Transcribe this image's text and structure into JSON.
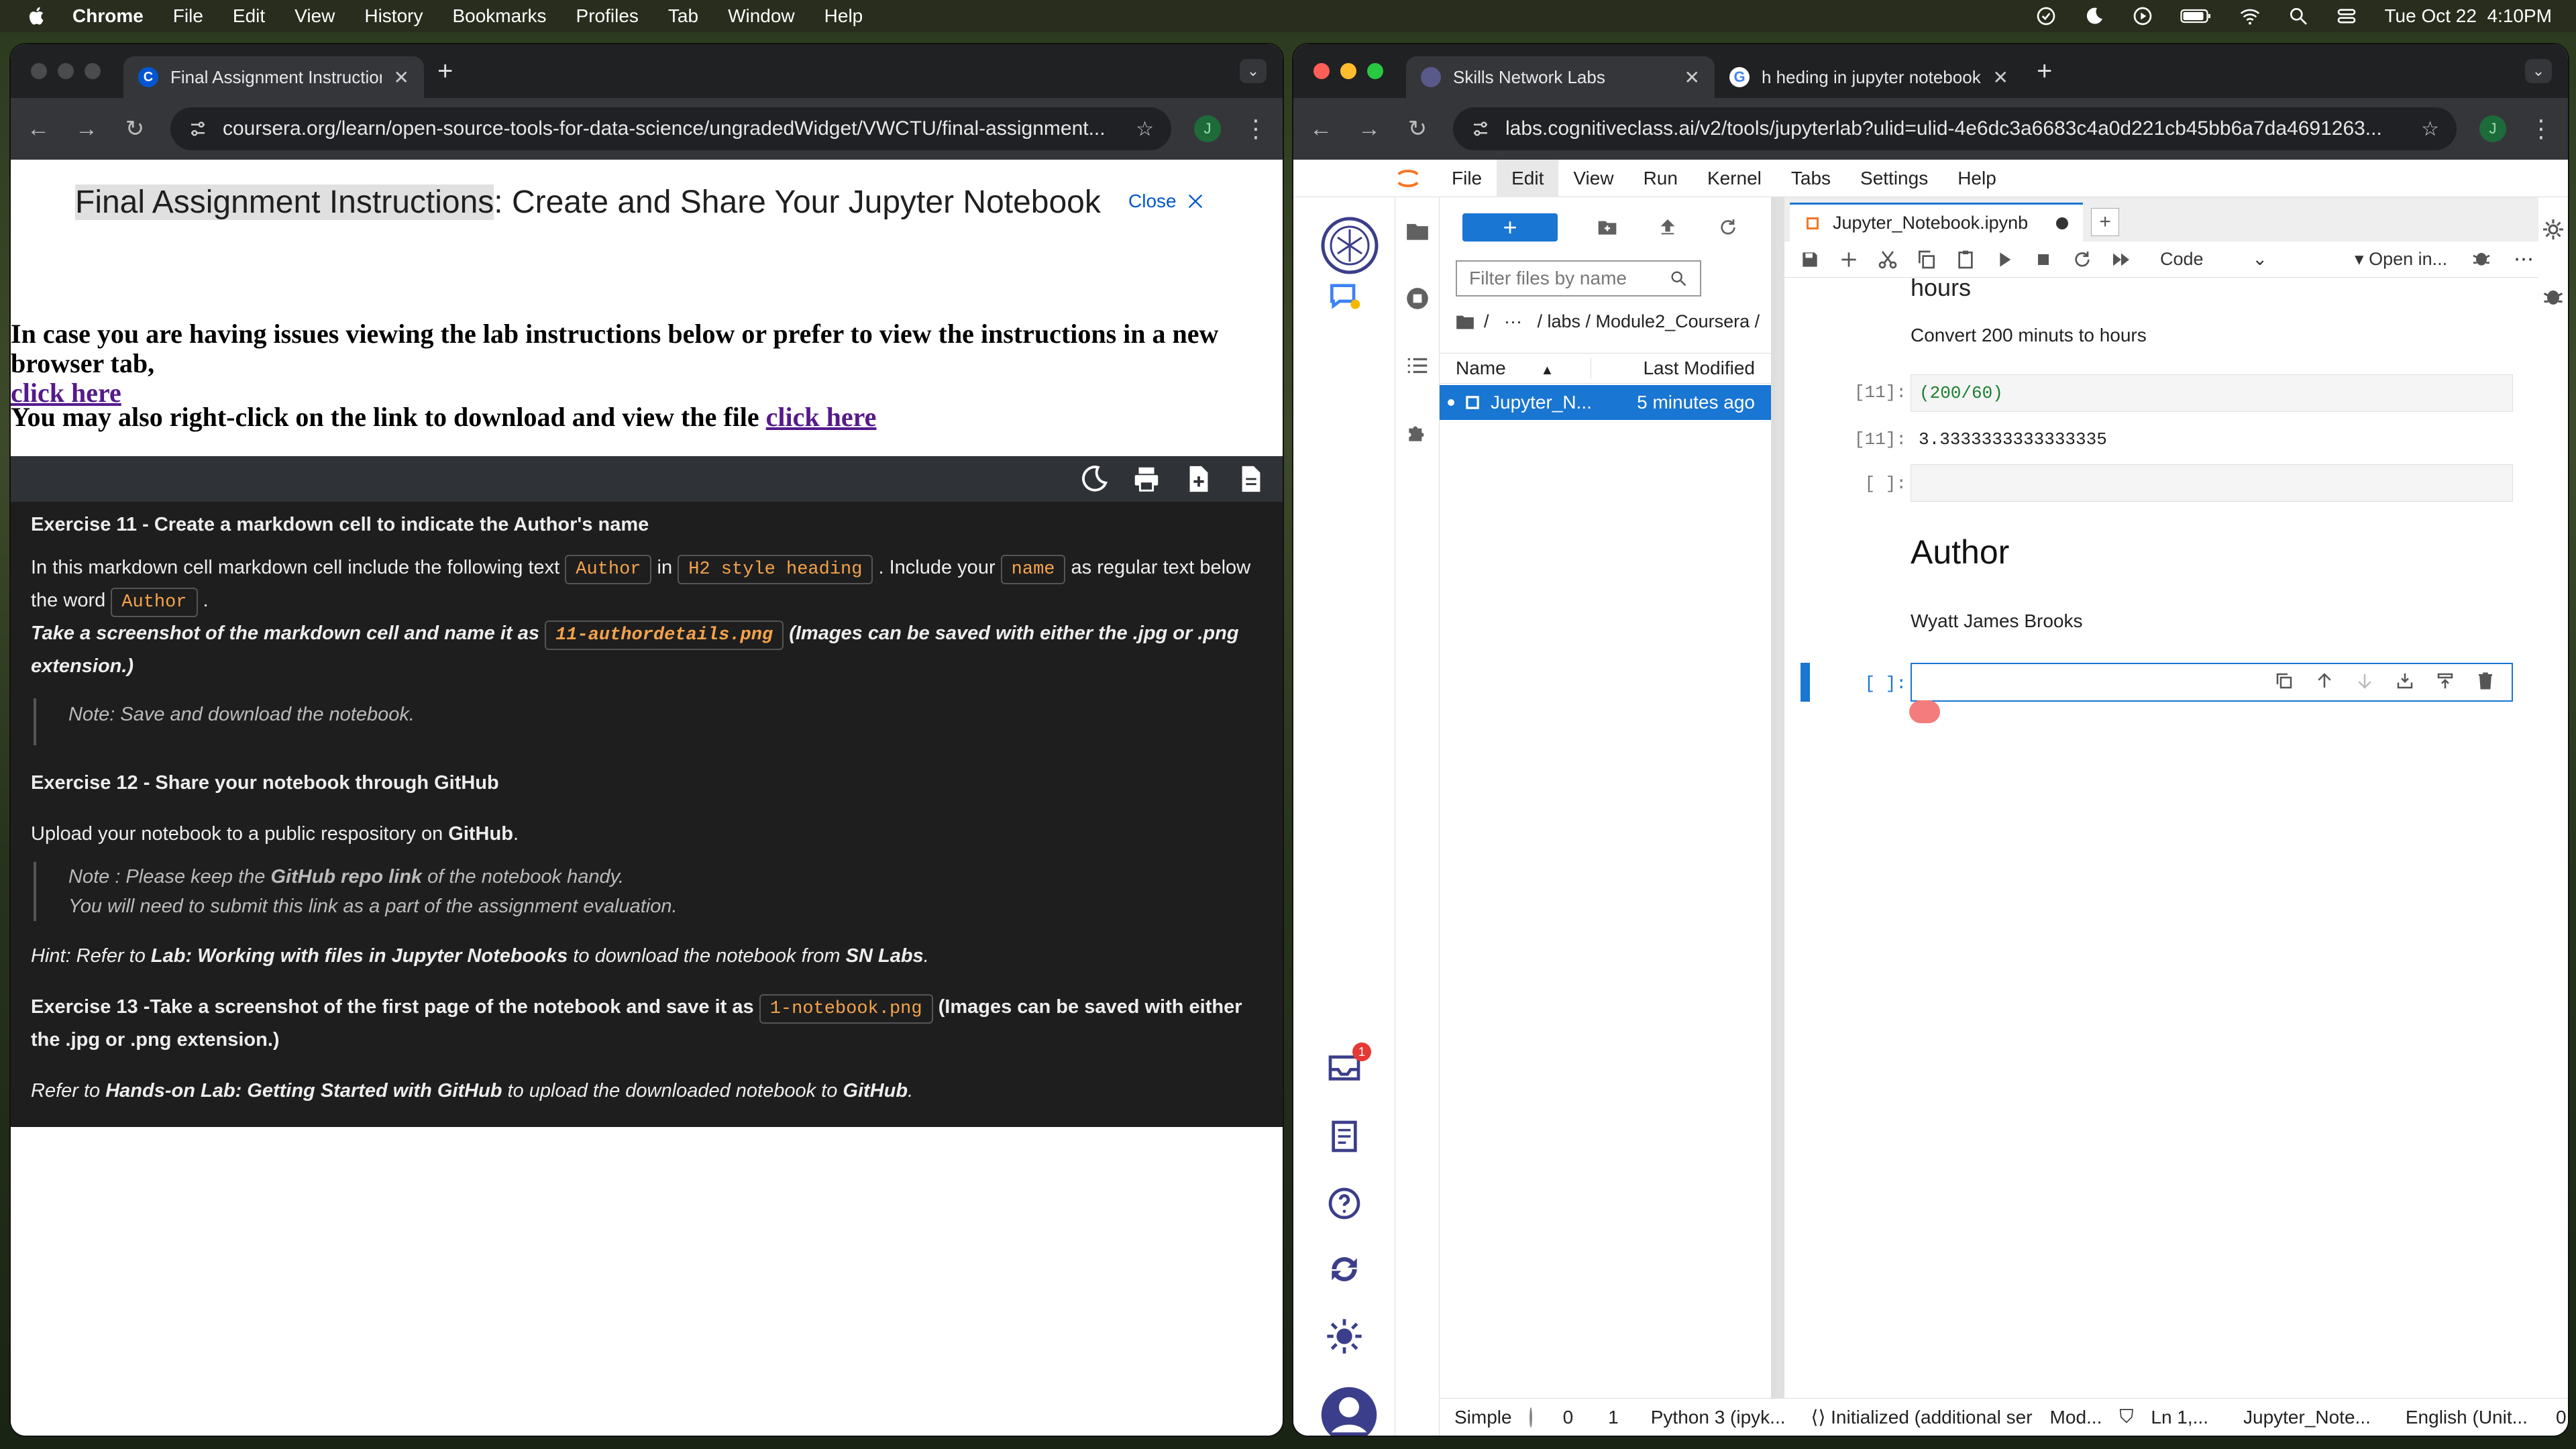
{
  "menubar": {
    "app": "Chrome",
    "items": [
      "File",
      "Edit",
      "View",
      "History",
      "Bookmarks",
      "Profiles",
      "Tab",
      "Window",
      "Help"
    ],
    "datetime": "Tue Oct 22  4:10PM"
  },
  "left_window": {
    "tab_title": "Final Assignment Instructions",
    "url": "coursera.org/learn/open-source-tools-for-data-science/ungradedWidget/VWCTU/final-assignment...",
    "profile_initial": "J",
    "page_title_highlight": "Final Assignment Instructions",
    "page_title_rest": ": Create and Share Your Jupyter Notebook",
    "close_label": "Close",
    "notice1_text": "In case you are having issues viewing the lab instructions below or prefer to view the instructions in a new browser tab,",
    "notice1_link": "click here",
    "notice2_text": "You may also right-click on the link to download and view the file",
    "notice2_link": "click here",
    "lab": {
      "ex11_heading": "Exercise 11 - Create a markdown cell to indicate the Author's name",
      "ex11_t1": "In this markdown cell markdown cell include the following text",
      "ex11_c1": "Author",
      "ex11_t2": "in",
      "ex11_c2": "H2 style heading",
      "ex11_t3": ". Include your",
      "ex11_c3": "name",
      "ex11_t4": "as regular text below the word",
      "ex11_c4": "Author",
      "ex11_t5": ".",
      "ex11_s1": "Take a screenshot of the markdown cell and name it as",
      "ex11_s_code": "11-authordetails.png",
      "ex11_s2": "(Images can be saved with either the .jpg or .png extension.)",
      "ex11_note": "Note: Save and download the notebook.",
      "ex12_heading": "Exercise 12 - Share your notebook through GitHub",
      "ex12_t1": "Upload your notebook to a public respository on",
      "ex12_t1b": "GitHub",
      "ex12_note_a": "Note : Please keep the",
      "ex12_note_b": "GitHub repo link",
      "ex12_note_c": "of the notebook handy.",
      "ex12_note2": "You will need to submit this link as a part of the assignment evaluation.",
      "hint_a": "Hint: Refer to",
      "hint_b": "Lab: Working with files in Jupyter Notebooks",
      "hint_c": "to download the notebook from",
      "hint_d": "SN Labs",
      "ex13_a": "Exercise 13 -Take a screenshot of the first page of the notebook and save it as",
      "ex13_code": "1-notebook.png",
      "ex13_b": "(Images can be saved with either the .jpg or .png extension.)",
      "ref_a": "Refer to",
      "ref_b": "Hands-on Lab: Getting Started with GitHub",
      "ref_c": "to upload the downloaded notebook to",
      "ref_d": "GitHub"
    }
  },
  "right_window": {
    "tab1_title": "Skills Network Labs",
    "tab2_title": "h heding in jupyter notebook",
    "url": "labs.cognitiveclass.ai/v2/tools/jupyterlab?ulid=ulid-4e6dc3a6683c4a0d221cb45bb6a7da4691263...",
    "profile_initial": "J",
    "jupyter_menu": [
      "File",
      "Edit",
      "View",
      "Run",
      "Kernel",
      "Tabs",
      "Settings",
      "Help"
    ],
    "notification_count": "1",
    "filebrowser": {
      "filter_placeholder": "Filter files by name",
      "crumb": "/   ···   / labs / Module2_Coursera /",
      "col_name": "Name",
      "col_modified": "Last Modified",
      "file_name": "Jupyter_N...",
      "file_modified": "5 minutes ago"
    },
    "notebook": {
      "tab_title": "Jupyter_Notebook.ipynb",
      "cell_type": "Code",
      "open_in": "Open in...",
      "md_hours": "hours",
      "md_convert": "Convert 200 minuts to hours",
      "in11_prompt": "[11]:",
      "in11_code": "(200/60)",
      "out11_prompt": "[11]:",
      "out11_value": "3.3333333333333335",
      "empty_prompt": "[ ]:",
      "h2_author": "Author",
      "author_name": "Wyatt James Brooks",
      "active_prompt": "[ ]:"
    },
    "status": {
      "mode": "Simple",
      "n1": "0",
      "n2": "1",
      "kernel": "Python 3 (ipyk...",
      "init": "Initialized (additional ser",
      "mod": "Mod...",
      "ln": "Ln 1,...",
      "file": "Jupyter_Note...",
      "lang": "English (Unit...",
      "n3": "0"
    }
  }
}
